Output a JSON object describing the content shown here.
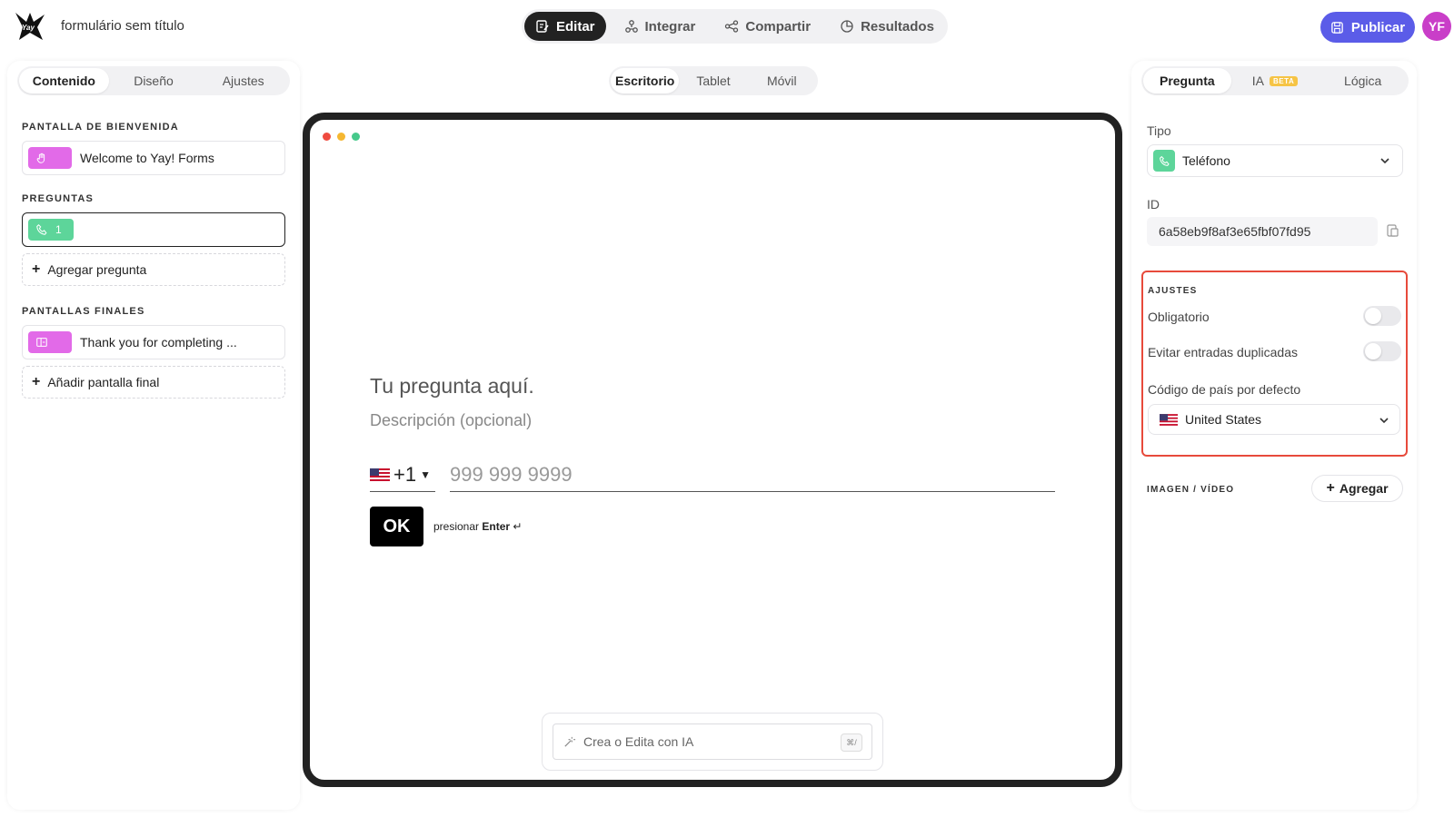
{
  "header": {
    "form_title": "formulário sem título",
    "tabs": [
      {
        "label": "Editar",
        "icon": "edit-icon"
      },
      {
        "label": "Integrar",
        "icon": "integrate-icon"
      },
      {
        "label": "Compartir",
        "icon": "share-icon"
      },
      {
        "label": "Resultados",
        "icon": "results-icon"
      }
    ],
    "publish_label": "Publicar",
    "avatar_initials": "YF"
  },
  "left": {
    "tabs": [
      "Contenido",
      "Diseño",
      "Ajustes"
    ],
    "welcome_section": "PANTALLA DE BIENVENIDA",
    "welcome_item": "Welcome to Yay! Forms",
    "questions_section": "PREGUNTAS",
    "question_number": "1",
    "add_question": "Agregar pregunta",
    "end_section": "PANTALLAS FINALES",
    "end_item": "Thank you for completing ...",
    "add_end": "Añadir pantalla final"
  },
  "center": {
    "device_tabs": [
      "Escritorio",
      "Tablet",
      "Móvil"
    ],
    "question_title": "Tu pregunta aquí.",
    "question_desc": "Descripción (opcional)",
    "country_code": "+1",
    "phone_placeholder": "999 999 9999",
    "ok_label": "OK",
    "hint_prefix": "presionar",
    "hint_key": "Enter",
    "hint_symbol": "↵",
    "ai_placeholder": "Crea o Edita con IA",
    "ai_shortcut": "⌘/",
    "dot_colors": [
      "#ef4b3f",
      "#f5b731",
      "#46c98b"
    ]
  },
  "right": {
    "tabs": [
      "Pregunta",
      "IA",
      "Lógica"
    ],
    "beta_badge": "BETA",
    "type_label": "Tipo",
    "type_value": "Teléfono",
    "id_label": "ID",
    "id_value": "6a58eb9f8af3e65fbf07fd95",
    "settings_title": "AJUSTES",
    "required_label": "Obligatorio",
    "required_on": false,
    "dup_label": "Evitar entradas duplicadas",
    "dup_on": false,
    "country_label": "Código de país por defecto",
    "country_value": "United States",
    "media_label": "IMAGEN / VÍDEO",
    "add_media": "Agregar"
  },
  "colors": {
    "accent": "#5b5ce8",
    "avatar": "#c93ec8",
    "welcome_chip": "#e26ae8",
    "phone_chip": "#5dd59a",
    "highlight_border": "#e74a3b",
    "beta": "#f6c445"
  }
}
